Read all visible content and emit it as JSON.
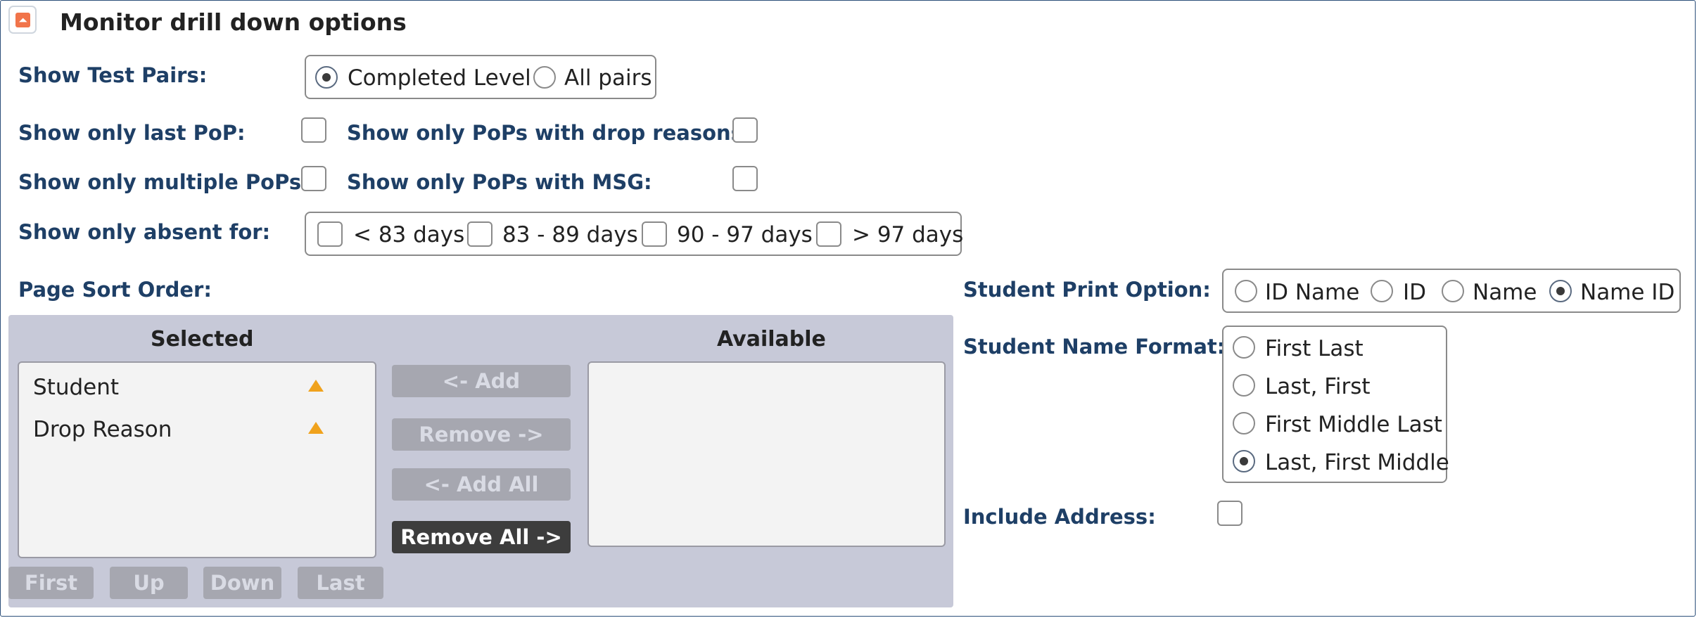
{
  "section": {
    "title": "Monitor drill down options",
    "collapse_icon": "chevron-up-icon"
  },
  "test_pairs": {
    "label": "Show Test Pairs:",
    "options": [
      "Completed Level",
      "All pairs"
    ],
    "selected": "Completed Level"
  },
  "last_pop": {
    "label": "Show only last PoP:",
    "checked": false
  },
  "drop_reasons": {
    "label": "Show only PoPs with drop reasons:",
    "checked": false
  },
  "multiple_pops": {
    "label": "Show only multiple PoPs:",
    "checked": false
  },
  "msg": {
    "label": "Show only PoPs with MSG:",
    "checked": false
  },
  "absent": {
    "label": "Show only absent for:",
    "options": [
      "< 83 days",
      "83 - 89 days",
      "90 - 97 days",
      "> 97 days"
    ]
  },
  "sort": {
    "label": "Page Sort Order:",
    "selected_header": "Selected",
    "available_header": "Available",
    "selected_items": [
      "Student",
      "Drop Reason"
    ],
    "available_items": [],
    "buttons": {
      "add": "<- Add",
      "remove": "Remove ->",
      "add_all": "<- Add All",
      "remove_all": "Remove All ->"
    },
    "order_buttons": {
      "first": "First",
      "up": "Up",
      "down": "Down",
      "last": "Last"
    }
  },
  "print_option": {
    "label": "Student Print Option:",
    "options": [
      "ID Name",
      "ID",
      "Name",
      "Name ID"
    ],
    "selected": "Name ID"
  },
  "name_format": {
    "label": "Student Name Format:",
    "options": [
      "First Last",
      "Last, First",
      "First Middle Last",
      "Last, First Middle"
    ],
    "selected": "Last, First Middle"
  },
  "address": {
    "label": "Include Address:",
    "checked": false
  },
  "colors": {
    "label_text": "#1e3f66",
    "sort_panel": "#c7c9d8",
    "disabled_button": "#a6a7b0",
    "active_button": "#3d3d3d",
    "sort_arrow": "#f0a21c",
    "collapse_icon": "#f1744a"
  }
}
